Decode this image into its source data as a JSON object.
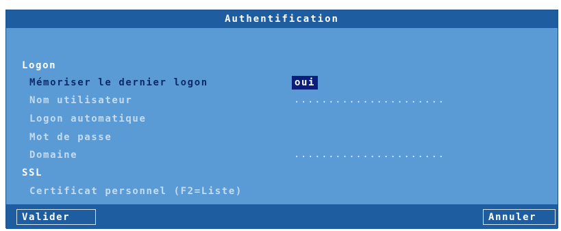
{
  "dialog": {
    "title": "Authentification"
  },
  "sections": {
    "logon_label": "Logon",
    "ssl_label": "SSL"
  },
  "fields": {
    "memoriser_label": "Mémoriser le dernier logon",
    "memoriser_value": "oui",
    "nom_utilisateur_label": "Nom utilisateur",
    "nom_utilisateur_value": "......................",
    "logon_auto_label": "Logon automatique",
    "mot_de_passe_label": "Mot de passe",
    "domaine_label": "Domaine",
    "domaine_value": "......................",
    "certificat_label": "Certificat personnel (F2=Liste)"
  },
  "buttons": {
    "valider": "Valider",
    "annuler": "Annuler"
  },
  "colors": {
    "dialog_background": "#5b9bd5",
    "titlebar": "#1f5da1",
    "selected_value": "#0b1f7a"
  }
}
